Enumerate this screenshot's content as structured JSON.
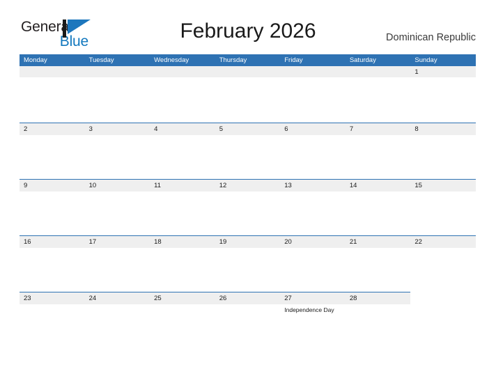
{
  "brand": {
    "name_part1": "General",
    "name_part2": "Blue",
    "mark_icon": "blue-flag-triangle-icon",
    "colors": {
      "text_dark": "#231f20",
      "blue": "#1278be"
    }
  },
  "header": {
    "title": "February 2026",
    "country": "Dominican Republic"
  },
  "calendar": {
    "colors": {
      "header_blue": "#2e72b3",
      "band_gray": "#efefef",
      "rule_blue": "#2e72b3"
    },
    "day_headers": [
      "Monday",
      "Tuesday",
      "Wednesday",
      "Thursday",
      "Friday",
      "Saturday",
      "Sunday"
    ],
    "weeks": [
      {
        "rule": false,
        "band_columns": 7,
        "days": [
          {
            "date": "",
            "event": ""
          },
          {
            "date": "",
            "event": ""
          },
          {
            "date": "",
            "event": ""
          },
          {
            "date": "",
            "event": ""
          },
          {
            "date": "",
            "event": ""
          },
          {
            "date": "",
            "event": ""
          },
          {
            "date": "1",
            "event": ""
          }
        ]
      },
      {
        "rule": true,
        "band_columns": 7,
        "days": [
          {
            "date": "2",
            "event": ""
          },
          {
            "date": "3",
            "event": ""
          },
          {
            "date": "4",
            "event": ""
          },
          {
            "date": "5",
            "event": ""
          },
          {
            "date": "6",
            "event": ""
          },
          {
            "date": "7",
            "event": ""
          },
          {
            "date": "8",
            "event": ""
          }
        ]
      },
      {
        "rule": true,
        "band_columns": 7,
        "days": [
          {
            "date": "9",
            "event": ""
          },
          {
            "date": "10",
            "event": ""
          },
          {
            "date": "11",
            "event": ""
          },
          {
            "date": "12",
            "event": ""
          },
          {
            "date": "13",
            "event": ""
          },
          {
            "date": "14",
            "event": ""
          },
          {
            "date": "15",
            "event": ""
          }
        ]
      },
      {
        "rule": true,
        "band_columns": 7,
        "days": [
          {
            "date": "16",
            "event": ""
          },
          {
            "date": "17",
            "event": ""
          },
          {
            "date": "18",
            "event": ""
          },
          {
            "date": "19",
            "event": ""
          },
          {
            "date": "20",
            "event": ""
          },
          {
            "date": "21",
            "event": ""
          },
          {
            "date": "22",
            "event": ""
          }
        ]
      },
      {
        "rule": true,
        "band_columns": 6,
        "days": [
          {
            "date": "23",
            "event": ""
          },
          {
            "date": "24",
            "event": ""
          },
          {
            "date": "25",
            "event": ""
          },
          {
            "date": "26",
            "event": ""
          },
          {
            "date": "27",
            "event": "Independence Day"
          },
          {
            "date": "28",
            "event": ""
          },
          {
            "date": "",
            "event": ""
          }
        ]
      }
    ]
  }
}
